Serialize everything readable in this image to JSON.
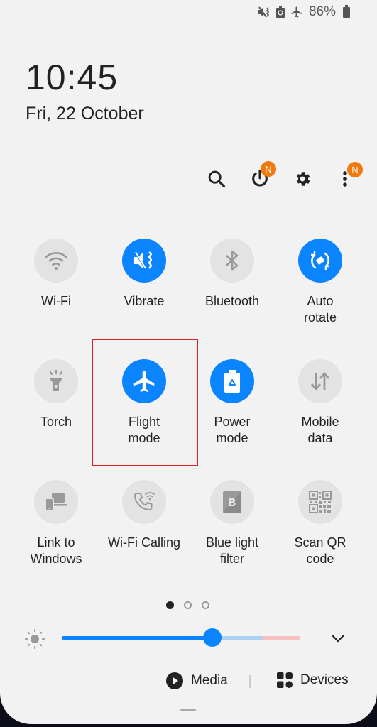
{
  "status_bar": {
    "icons": [
      "vibrate-icon",
      "power-saving-icon",
      "airplane-icon"
    ],
    "battery_percent": "86%"
  },
  "clock": {
    "time": "10:45",
    "date": "Fri, 22 October"
  },
  "top_actions": {
    "items": [
      {
        "name": "search",
        "badge": null
      },
      {
        "name": "power",
        "badge": "N"
      },
      {
        "name": "settings",
        "badge": null
      },
      {
        "name": "more-options",
        "badge": "N"
      }
    ]
  },
  "tiles": [
    {
      "label": "Wi-Fi",
      "icon": "wifi-icon",
      "state": "off"
    },
    {
      "label": "Vibrate",
      "icon": "vibrate-icon",
      "state": "on"
    },
    {
      "label": "Bluetooth",
      "icon": "bluetooth-icon",
      "state": "off"
    },
    {
      "label": "Auto\nrotate",
      "icon": "auto-rotate-icon",
      "state": "on"
    },
    {
      "label": "Torch",
      "icon": "torch-icon",
      "state": "off"
    },
    {
      "label": "Flight\nmode",
      "icon": "airplane-icon",
      "state": "on"
    },
    {
      "label": "Power\nmode",
      "icon": "power-saving-icon",
      "state": "on"
    },
    {
      "label": "Mobile\ndata",
      "icon": "mobile-data-icon",
      "state": "off"
    },
    {
      "label": "Link to\nWindows",
      "icon": "link-to-windows-icon",
      "state": "off"
    },
    {
      "label": "Wi-Fi Calling",
      "icon": "wifi-calling-icon",
      "state": "off"
    },
    {
      "label": "Blue light\nfilter",
      "icon": "blue-light-filter-icon",
      "state": "off"
    },
    {
      "label": "Scan QR\ncode",
      "icon": "qr-code-icon",
      "state": "off"
    }
  ],
  "highlighted_tile": "Flight mode",
  "pager": {
    "pages": 3,
    "current": 1
  },
  "brightness": {
    "level_percent": 63
  },
  "bottom": {
    "media_label": "Media",
    "devices_label": "Devices"
  },
  "colors": {
    "accent": "#0a84ff",
    "badge": "#f07a10",
    "highlight": "#e02020",
    "panel_bg": "#f2f2f2"
  }
}
